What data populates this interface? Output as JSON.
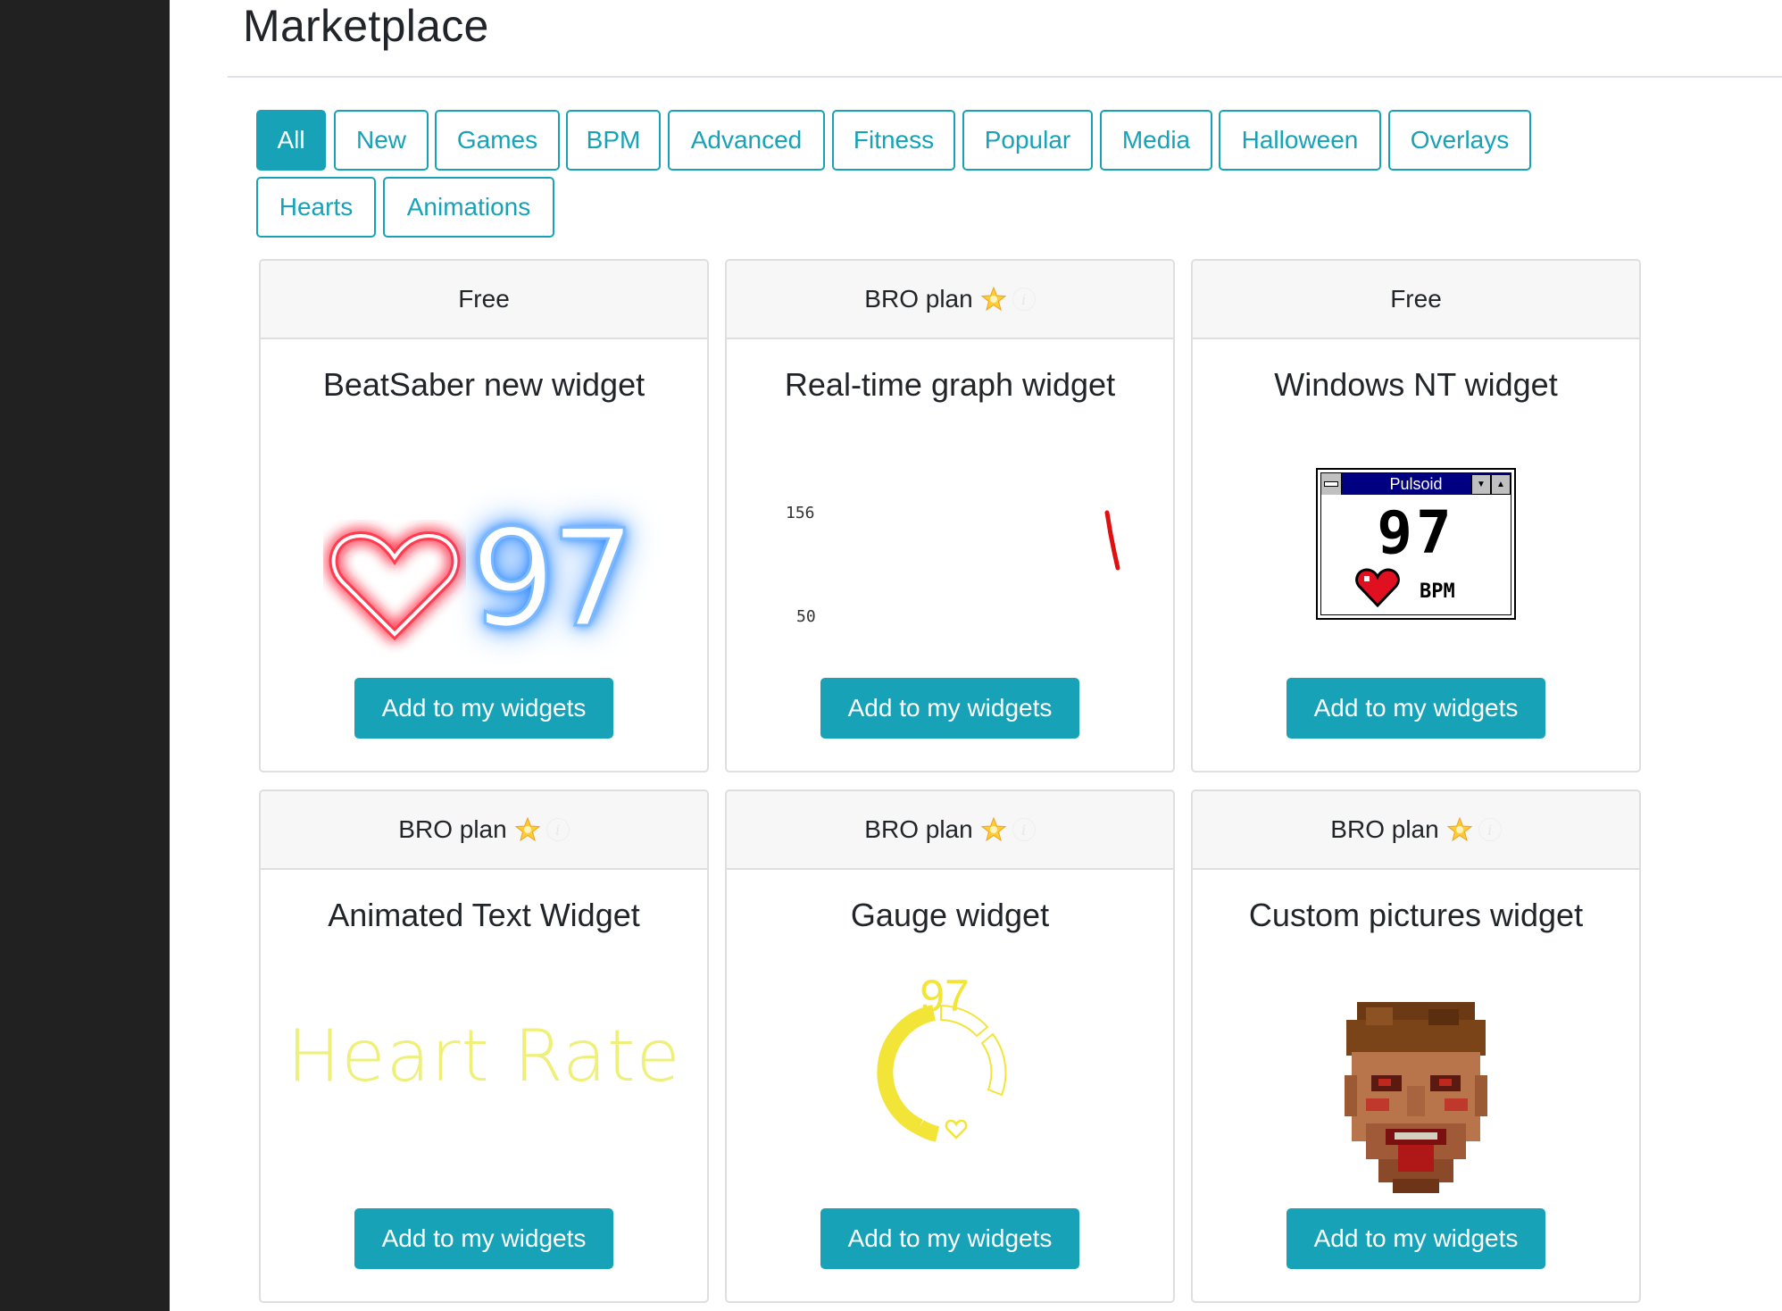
{
  "page": {
    "title": "Marketplace"
  },
  "filters": [
    "All",
    "New",
    "Games",
    "BPM",
    "Advanced",
    "Fitness",
    "Popular",
    "Media",
    "Halloween",
    "Overlays",
    "Hearts",
    "Animations"
  ],
  "active_filter": "All",
  "colors": {
    "accent": "#17a2b8",
    "sidebar": "#212121",
    "card_header_bg": "#f7f7f7"
  },
  "widgets": [
    {
      "plan": "Free",
      "title": "BeatSaber new widget",
      "preview_value": "97",
      "button": "Add to my widgets"
    },
    {
      "plan": "BRO plan",
      "plan_icon": "star-icon",
      "title": "Real-time graph widget",
      "graph_max": "156",
      "graph_min": "50",
      "button": "Add to my widgets"
    },
    {
      "plan": "Free",
      "title": "Windows NT widget",
      "window_title": "Pulsoid",
      "preview_value": "97",
      "unit": "BPM",
      "button": "Add to my widgets"
    },
    {
      "plan": "BRO plan",
      "plan_icon": "star-icon",
      "title": "Animated Text Widget",
      "preview_text": "Heart Rate",
      "button": "Add to my widgets"
    },
    {
      "plan": "BRO plan",
      "plan_icon": "star-icon",
      "title": "Gauge widget",
      "preview_value": "97",
      "button": "Add to my widgets"
    },
    {
      "plan": "BRO plan",
      "plan_icon": "star-icon",
      "title": "Custom pictures widget",
      "button": "Add to my widgets"
    }
  ]
}
